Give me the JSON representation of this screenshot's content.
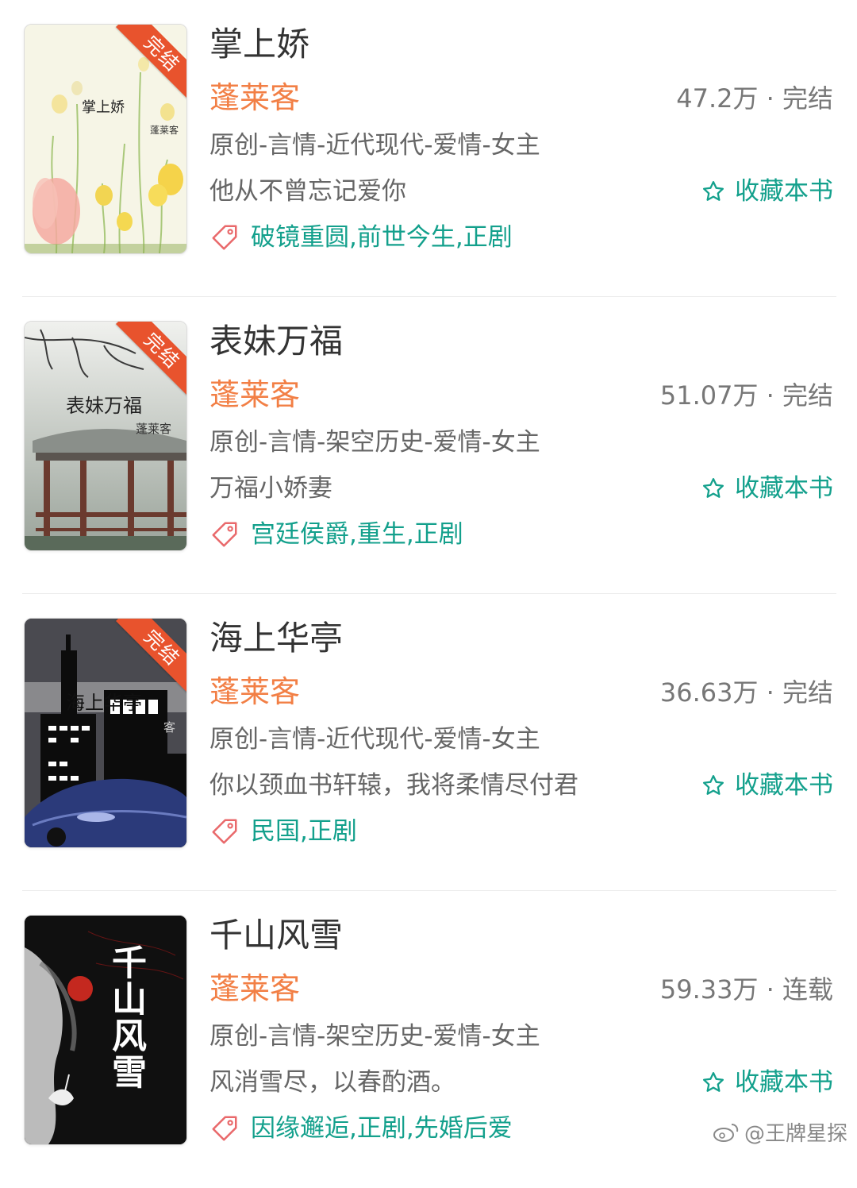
{
  "collect_label": "收藏本书",
  "books": [
    {
      "title": "掌上娇",
      "author": "蓬莱客",
      "stats": "47.2万 · 完结",
      "genre": "原创-言情-近代现代-爱情-女主",
      "intro": "他从不曾忘记爱你",
      "tags": "破镜重圆,前世今生,正剧",
      "badge": "完结",
      "cover_title": "掌上娇",
      "cover_author": "蓬莱客"
    },
    {
      "title": "表妹万福",
      "author": "蓬莱客",
      "stats": "51.07万 · 完结",
      "genre": "原创-言情-架空历史-爱情-女主",
      "intro": "万福小娇妻",
      "tags": "宫廷侯爵,重生,正剧",
      "badge": "完结",
      "cover_title": "表妹万福",
      "cover_author": "蓬莱客"
    },
    {
      "title": "海上华亭",
      "author": "蓬莱客",
      "stats": "36.63万 · 完结",
      "genre": "原创-言情-近代现代-爱情-女主",
      "intro": "你以颈血书轩辕，我将柔情尽付君",
      "tags": "民国,正剧",
      "badge": "完结",
      "cover_title": "海上华亭",
      "cover_author": "客"
    },
    {
      "title": "千山风雪",
      "author": "蓬莱客",
      "stats": "59.33万 · 连载",
      "genre": "原创-言情-架空历史-爱情-女主",
      "intro": "风消雪尽，以春酌酒。",
      "tags": "因缘邂逅,正剧,先婚后爱",
      "cover_title": "千山风雪"
    }
  ],
  "watermark": "@王牌星探",
  "colors": {
    "author": "#f27f45",
    "accent": "#13a08c",
    "badge": "#e8532d",
    "text": "#333333",
    "subtext": "#666666"
  },
  "icons": [
    "star-outline-icon",
    "tag-icon",
    "weibo-icon"
  ]
}
